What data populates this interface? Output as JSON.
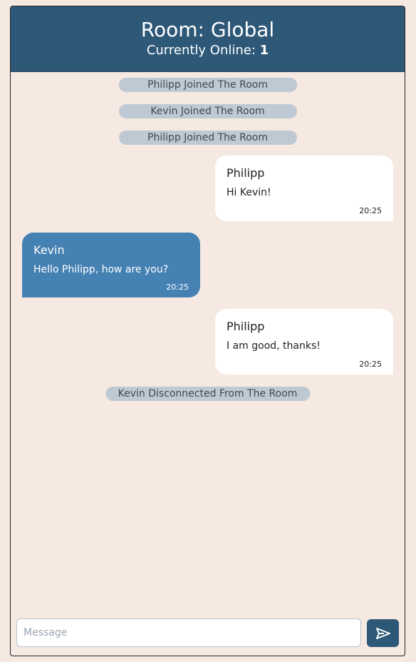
{
  "header": {
    "room_title": "Room: Global",
    "online_label": "Currently Online: ",
    "online_count": "1"
  },
  "messages": [
    {
      "kind": "system",
      "text": "Philipp Joined The Room"
    },
    {
      "kind": "system",
      "text": "Kevin Joined The Room"
    },
    {
      "kind": "system",
      "text": "Philipp Joined The Room"
    },
    {
      "kind": "own",
      "sender": "Philipp",
      "text": "Hi Kevin!",
      "time": "20:25"
    },
    {
      "kind": "other",
      "sender": "Kevin",
      "text": "Hello Philipp, how are you?",
      "time": "20:25"
    },
    {
      "kind": "own",
      "sender": "Philipp",
      "text": "I am good, thanks!",
      "time": "20:25"
    },
    {
      "kind": "system",
      "text": "Kevin Disconnected From The Room"
    }
  ],
  "composer": {
    "placeholder": "Message",
    "value": "",
    "send_icon": "send-icon"
  },
  "colors": {
    "header": "#2e5878",
    "background": "#f5e9e1",
    "other_bubble": "#4581b3",
    "own_bubble": "#ffffff",
    "system_pill": "#bfc9d4"
  }
}
